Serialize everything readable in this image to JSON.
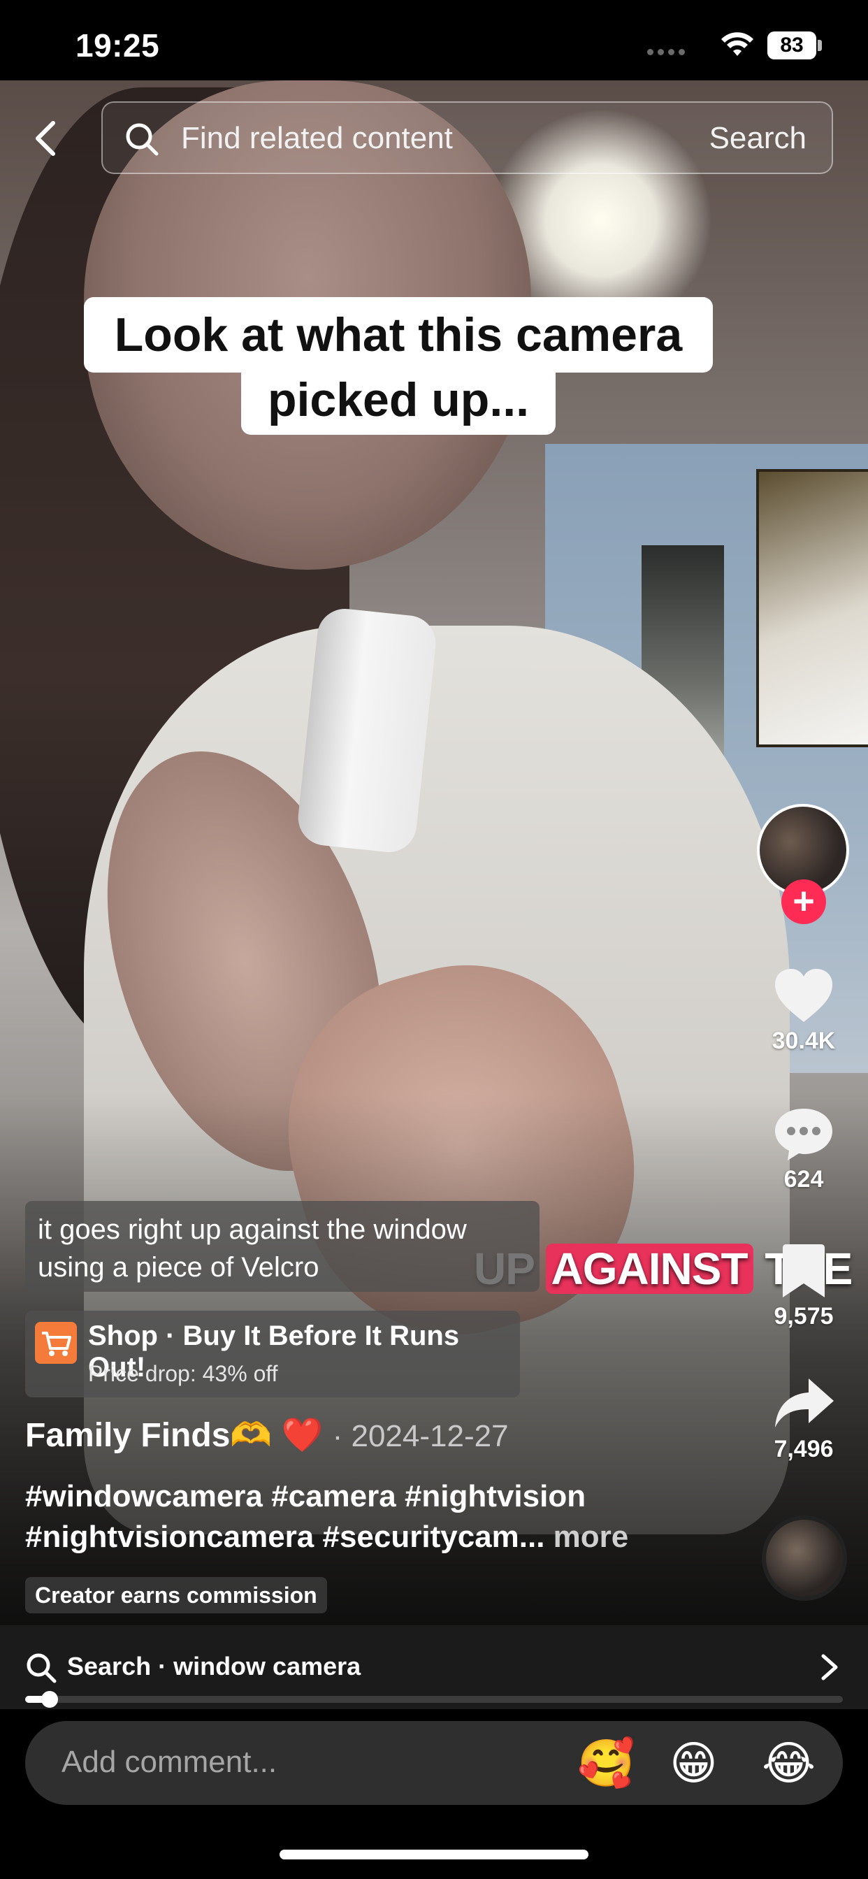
{
  "status_bar": {
    "time": "19:25",
    "battery": "83"
  },
  "top_bar": {
    "search_placeholder": "Find related content",
    "search_button": "Search"
  },
  "caption": {
    "line1": "Look at what this camera",
    "line2": "picked up..."
  },
  "burned_subtitle": {
    "word1": "UP",
    "highlight": "AGAINST",
    "word3": "THE"
  },
  "subtitle_box": {
    "line1": "it goes right up against the window",
    "line2": "using a piece of Velcro"
  },
  "shop": {
    "title": "Shop · Buy It Before It Runs Out!",
    "subtitle": "Price drop: 43% off"
  },
  "author": {
    "name": "Family Finds",
    "emoji_hands": "🫶",
    "emoji_heart": "❤️",
    "date": "· 2024-12-27"
  },
  "description": {
    "line1": "#windowcamera #camera #nightvision",
    "line2": "#nightvisioncamera #securitycam...",
    "more": " more"
  },
  "commission_label": "Creator earns commission",
  "rail": {
    "likes": "30.4K",
    "comments": "624",
    "saves": "9,575",
    "shares": "7,496",
    "follow_symbol": "+"
  },
  "related_search": {
    "label": "Search · window camera"
  },
  "playback": {
    "progress": 0.03
  },
  "comment": {
    "placeholder": "Add comment...",
    "emojis": [
      "🥰",
      "😁",
      "😂"
    ]
  },
  "colors": {
    "accent": "#fe2c55",
    "shop_icon": "#f47b3a"
  }
}
